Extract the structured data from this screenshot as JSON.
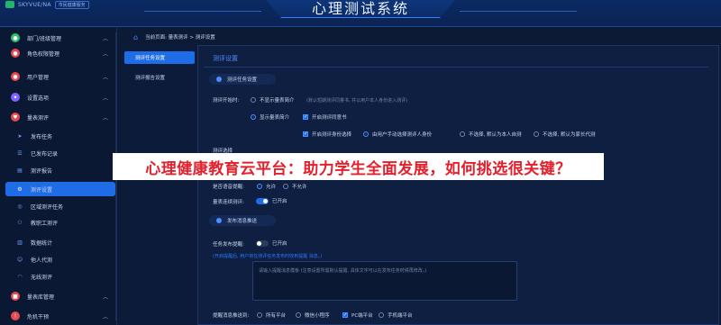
{
  "header": {
    "logo_text": "SKYVUE/NA",
    "logo_badge": "市民健康服务",
    "title": "心理测试系统"
  },
  "sidebar": {
    "items": [
      {
        "label": "部门/班级管理",
        "icon": "users-icon",
        "color": "#2fbf71",
        "top": 0
      },
      {
        "label": "角色权限管理",
        "icon": "role-icon",
        "color": "#e5484d"
      },
      {
        "label": "用户管理",
        "icon": "user-icon",
        "color": "#e5484d"
      },
      {
        "label": "设置选项",
        "icon": "settings-icon",
        "color": "#7b61ff"
      },
      {
        "label": "量表测评",
        "icon": "heart-icon",
        "color": "#e5484d"
      }
    ],
    "subitems": [
      {
        "label": "发布任务"
      },
      {
        "label": "已发布记录"
      },
      {
        "label": "测评报告"
      },
      {
        "label": "测评设置"
      },
      {
        "label": "区域测评任务"
      },
      {
        "label": "教职工测评"
      },
      {
        "label": "数据统计"
      },
      {
        "label": "他人代测"
      },
      {
        "label": "无线测评"
      }
    ],
    "bottom_items": [
      {
        "label": "量表库管理"
      },
      {
        "label": "危机干预"
      }
    ]
  },
  "breadcrumb": {
    "text": "当前页面: 量表测评 > 测评设置"
  },
  "tabs": [
    {
      "label": "测评任务设置"
    },
    {
      "label": "测评报告设置"
    }
  ],
  "main": {
    "section_title": "测评设置",
    "group1": "测评任务设置",
    "start_label": "测评开始时:",
    "start_opt1": "不显示量表简介",
    "start_hint": "(默认短期测评同量书, 并以用户本人身份进入测评)",
    "start_opt2": "显示量表简介",
    "start_opt3": "开启测评同意书",
    "identity_opt1": "开启测评身份选择",
    "identity_opt2": "由用户手动选择测评人身份",
    "identity_opt3": "不选择, 默认为本人自测",
    "identity_opt4": "不选择, 默认为家长代测",
    "row_partial": "测评选择",
    "voice_label": "是否语音提醒:",
    "voice_allow": "允许",
    "voice_deny": "不允许",
    "skip_label": "量表连续测评:",
    "skip_value": "已开启",
    "group2": "发布消息推送",
    "notify_label": "任务发布提醒:",
    "notify_value": "已开启",
    "notify_note": "(开启提醒后, 用户将在测评任务发布时收到提醒 消息。)",
    "textarea_placeholder": "请输入提醒消息模板 (注意设置所需默认提醒, 具体文字可以在发布任务时候再修改。)",
    "channel_label": "提醒消息推送到:",
    "channels": [
      "所有平台",
      "微信小程序",
      "PC端平台",
      "手机端平台"
    ]
  },
  "banner": {
    "text": "心理健康教育云平台：助力学生全面发展，如何挑选很关键？"
  }
}
